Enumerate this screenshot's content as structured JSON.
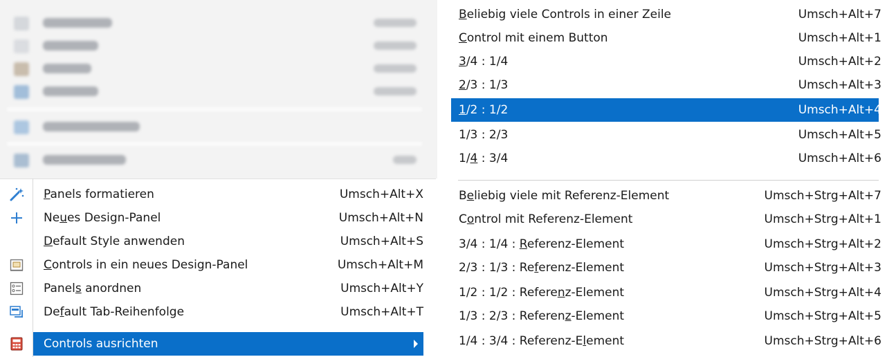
{
  "colors": {
    "highlight": "#0a6fc9",
    "highlight_text": "#ffffff"
  },
  "left_menu": {
    "items": [
      {
        "icon": "wand-icon",
        "label_pre": "",
        "label_u": "P",
        "label_post": "anels formatieren",
        "shortcut": "Umsch+Alt+X"
      },
      {
        "icon": "plus-icon",
        "label_pre": "Ne",
        "label_u": "u",
        "label_post": "es Design-Panel",
        "shortcut": "Umsch+Alt+N"
      },
      {
        "icon": "",
        "label_pre": "",
        "label_u": "D",
        "label_post": "efault Style anwenden",
        "shortcut": "Umsch+Alt+S"
      },
      {
        "icon": "panel-icon",
        "label_pre": "",
        "label_u": "C",
        "label_post": "ontrols in ein neues Design-Panel",
        "shortcut": "Umsch+Alt+M"
      },
      {
        "icon": "arrange-icon",
        "label_pre": "Panel",
        "label_u": "s",
        "label_post": " anordnen",
        "shortcut": "Umsch+Alt+Y"
      },
      {
        "icon": "tab-order-icon",
        "label_pre": "De",
        "label_u": "f",
        "label_post": "ault Tab-Reihenfolge",
        "shortcut": "Umsch+Alt+T"
      },
      {
        "icon": "calculator-icon",
        "label_pre": "Controls ausrichten",
        "label_u": "",
        "label_post": "",
        "shortcut": ""
      }
    ]
  },
  "right_menu": {
    "items": [
      {
        "label_pre": "",
        "label_u": "B",
        "label_post": "eliebig viele Controls in einer Zeile",
        "shortcut": "Umsch+Alt+7"
      },
      {
        "label_pre": "",
        "label_u": "C",
        "label_post": "ontrol mit einem Button",
        "shortcut": "Umsch+Alt+1"
      },
      {
        "label_pre": "",
        "label_u": "3",
        "label_post": "/4 : 1/4",
        "shortcut": "Umsch+Alt+2"
      },
      {
        "label_pre": "",
        "label_u": "2",
        "label_post": "/3 : 1/3",
        "shortcut": "Umsch+Alt+3"
      },
      {
        "label_pre": "",
        "label_u": "1",
        "label_post": "/2 : 1/2",
        "shortcut": "Umsch+Alt+4"
      },
      {
        "label_pre": "1/3 : 2/3",
        "label_u": "",
        "label_post": "",
        "shortcut": "Umsch+Alt+5"
      },
      {
        "label_pre": "1/",
        "label_u": "4",
        "label_post": " : 3/4",
        "shortcut": "Umsch+Alt+6"
      },
      {
        "label_pre": "B",
        "label_u": "e",
        "label_post": "liebig viele mit Referenz-Element",
        "shortcut": "Umsch+Strg+Alt+7"
      },
      {
        "label_pre": "C",
        "label_u": "o",
        "label_post": "ntrol mit Referenz-Element",
        "shortcut": "Umsch+Strg+Alt+1"
      },
      {
        "label_pre": "3/4 : 1/4 : ",
        "label_u": "R",
        "label_post": "eferenz-Element",
        "shortcut": "Umsch+Strg+Alt+2"
      },
      {
        "label_pre": "2/3 : 1/3 : Re",
        "label_u": "f",
        "label_post": "erenz-Element",
        "shortcut": "Umsch+Strg+Alt+3"
      },
      {
        "label_pre": "1/2 : 1/2 : Refere",
        "label_u": "n",
        "label_post": "z-Element",
        "shortcut": "Umsch+Strg+Alt+4"
      },
      {
        "label_pre": "1/3 : 2/3 : Referen",
        "label_u": "z",
        "label_post": "-Element",
        "shortcut": "Umsch+Strg+Alt+5"
      },
      {
        "label_pre": "1/4 : 3/4 : Referenz-E",
        "label_u": "l",
        "label_post": "ement",
        "shortcut": "Umsch+Strg+Alt+6"
      }
    ]
  }
}
